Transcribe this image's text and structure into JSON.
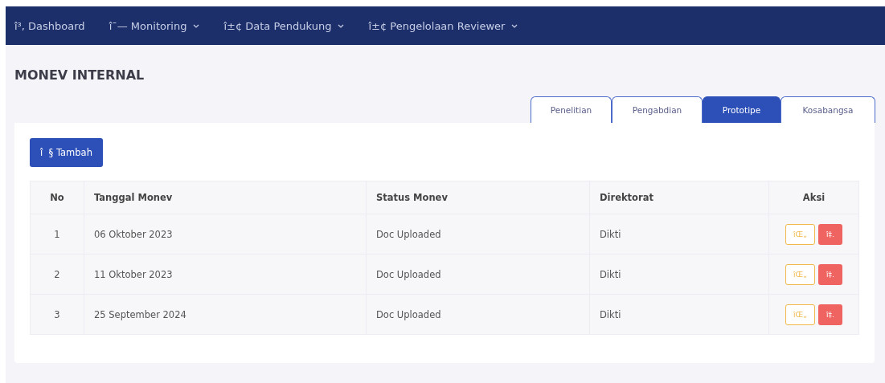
{
  "navbar": {
    "items": [
      {
        "label": "î³, Dashboard",
        "dropdown": false
      },
      {
        "label": "î¯— Monitoring",
        "dropdown": true
      },
      {
        "label": "î±¢ Data Pendukung",
        "dropdown": true
      },
      {
        "label": "î±¢ Pengelolaan Reviewer",
        "dropdown": true
      }
    ]
  },
  "page_title": "MONEV INTERNAL",
  "tabs": [
    {
      "label": "Penelitian",
      "selected": false
    },
    {
      "label": "Pengabdian",
      "selected": false
    },
    {
      "label": "Prototipe",
      "selected": true
    },
    {
      "label": "Kosabangsa",
      "selected": false
    }
  ],
  "add_button": "î  § Tambah",
  "table": {
    "columns": [
      "No",
      "Tanggal Monev",
      "Status Monev",
      "Direktorat",
      "Aksi"
    ],
    "rows": [
      {
        "no": "1",
        "tanggal": "06 Oktober 2023",
        "status": "Doc Uploaded",
        "direktorat": "Dikti",
        "actions": [
          "îŒ„",
          "î‡."
        ]
      },
      {
        "no": "2",
        "tanggal": "11 Oktober 2023",
        "status": "Doc Uploaded",
        "direktorat": "Dikti",
        "actions": [
          "îŒ„",
          "î‡."
        ]
      },
      {
        "no": "3",
        "tanggal": "25 September 2024",
        "status": "Doc Uploaded",
        "direktorat": "Dikti",
        "actions": [
          "îŒ„",
          "î‡."
        ]
      }
    ]
  }
}
